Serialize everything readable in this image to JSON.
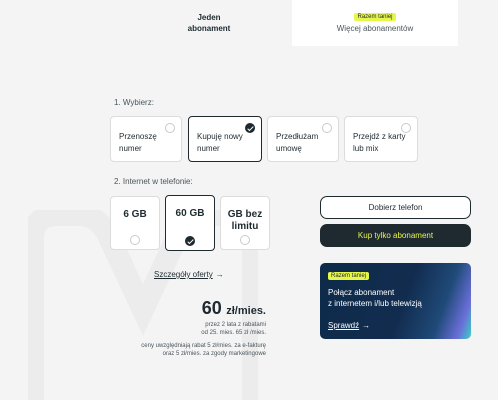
{
  "tabs": [
    {
      "title_line1": "Jeden",
      "title_line2": "abonament",
      "active": true
    },
    {
      "badge": "Razem taniej",
      "label": "Więcej abonamentów",
      "active": false
    }
  ],
  "step1": {
    "label": "1. Wybierz:",
    "options": [
      {
        "line1": "Przenoszę",
        "line2": "numer",
        "selected": false
      },
      {
        "line1": "Kupuję nowy",
        "line2": "numer",
        "selected": true
      },
      {
        "line1": "Przedłużam",
        "line2": "umowę",
        "selected": false
      },
      {
        "line1": "Przejdź z karty",
        "line2": "lub mix",
        "selected": false
      }
    ]
  },
  "step2": {
    "label": "2. Internet w telefonie:",
    "options": [
      {
        "line1": "6 GB",
        "line2": "",
        "selected": false
      },
      {
        "line1": "60 GB",
        "line2": "",
        "selected": true
      },
      {
        "line1": "GB bez",
        "line2": "limitu",
        "selected": false
      }
    ]
  },
  "details_link": "Szczegóły oferty",
  "price": {
    "amount": "60",
    "unit": "zł/mies.",
    "note1_line1": "przez 2 lata z rabatami",
    "note1_line2": "od 25. mies. 65 zł /mies.",
    "note2_line1": "ceny uwzględniają rabat 5 zł/mies. za e-fakturę",
    "note2_line2": "oraz 5 zł/mies. za zgody marketingowe"
  },
  "buttons": {
    "choose_phone": "Dobierz telefon",
    "buy_plan": "Kup tylko abonament"
  },
  "promo": {
    "badge": "Razem taniej",
    "line1": "Połącz abonament",
    "line2": "z internetem i/lub telewizją",
    "link": "Sprawdź"
  },
  "colors": {
    "dark": "#1e2a30",
    "accent": "#e6f64a",
    "background": "#f4f4f4"
  }
}
